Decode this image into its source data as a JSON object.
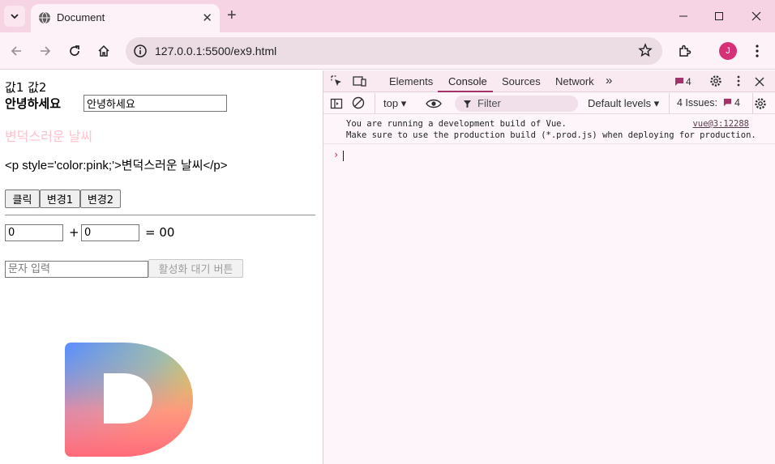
{
  "browser": {
    "tab_title": "Document",
    "url": "127.0.0.1:5500/ex9.html",
    "profile_initial": "J"
  },
  "page": {
    "line1": "값1 값2",
    "greeting_label": "안녕하세요",
    "greeting_input_value": "안녕하세요",
    "pink_text": "변덕스러운 날씨",
    "raw_html_text": "<p style='color:pink;'>변덕스러운 날씨</p>",
    "buttons": [
      "클릭",
      "변경1",
      "변경2"
    ],
    "num1_value": "0",
    "plus": "+",
    "num2_value": "0",
    "equals_result": "= 00",
    "text_placeholder": "문자 입력",
    "disabled_button": "활성화 대기 버튼"
  },
  "devtools": {
    "tabs": [
      "Elements",
      "Console",
      "Sources",
      "Network"
    ],
    "active_tab": "Console",
    "messages_badge": "4",
    "context": "top",
    "filter_placeholder": "Filter",
    "levels": "Default levels",
    "issues_label": "4 Issues:",
    "issues_count": "4",
    "console_line1": "You are running a development build of Vue.",
    "console_line2": "Make sure to use the production build (*.prod.js) when deploying for production.",
    "console_source": "vue@3:12288"
  },
  "colors": {
    "tabbar": "#f7d4e4",
    "toolbar": "#fdf2f7",
    "accent": "#c2185b",
    "pink_text": "pink"
  }
}
